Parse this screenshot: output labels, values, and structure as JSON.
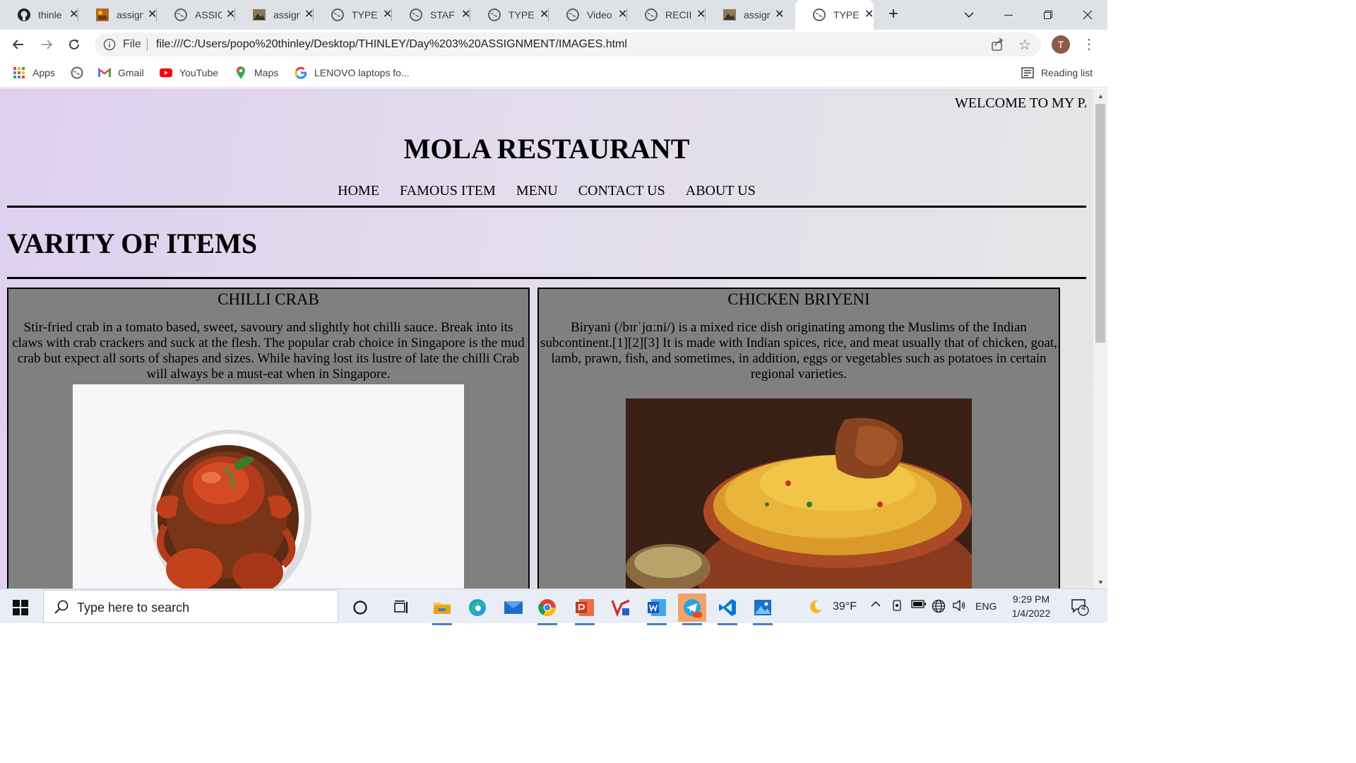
{
  "browser": {
    "tabs": [
      {
        "label": "thinle",
        "icon": "github-icon",
        "active": false
      },
      {
        "label": "assign",
        "icon": "image-icon",
        "active": false
      },
      {
        "label": "ASSIG",
        "icon": "globe-icon",
        "active": false
      },
      {
        "label": "assign",
        "icon": "image-icon",
        "active": false
      },
      {
        "label": "TYPE",
        "icon": "globe-icon",
        "active": false
      },
      {
        "label": "STAF",
        "icon": "globe-icon",
        "active": false
      },
      {
        "label": "TYPE",
        "icon": "globe-icon",
        "active": false
      },
      {
        "label": "Video",
        "icon": "globe-icon",
        "active": false
      },
      {
        "label": "RECII",
        "icon": "globe-icon",
        "active": false
      },
      {
        "label": "assign",
        "icon": "image-icon",
        "active": false
      },
      {
        "label": "TYPE",
        "icon": "globe-icon",
        "active": true
      }
    ],
    "new_tab": "+",
    "omnibox": {
      "scheme_label": "File",
      "url": "file:///C:/Users/popo%20thinley/Desktop/THINLEY/Day%203%20ASSIGNMENT/IMAGES.html"
    },
    "profile_initial": "T",
    "bookmarks": [
      {
        "label": "Apps",
        "icon": "apps-grid-icon"
      },
      {
        "label": "",
        "icon": "globe-icon"
      },
      {
        "label": "Gmail",
        "icon": "gmail-icon"
      },
      {
        "label": "YouTube",
        "icon": "youtube-icon"
      },
      {
        "label": "Maps",
        "icon": "maps-pin-icon"
      },
      {
        "label": "LENOVO laptops fo...",
        "icon": "google-icon"
      }
    ],
    "reading_list": "Reading list"
  },
  "page": {
    "marquee": "WELCOME TO MY PA",
    "site_title": "MOLA RESTAURANT",
    "nav": [
      "HOME",
      "FAMOUS ITEM",
      "MENU",
      "CONTACT US",
      "ABOUT US"
    ],
    "section_title": "VARITY OF ITEMS",
    "cards": [
      {
        "title": "CHILLI CRAB",
        "description": "Stir-fried crab in a tomato based, sweet, savoury and slightly hot chilli sauce. Break into its claws with crab crackers and suck at the flesh. The popular crab choice in Singapore is the mud crab but expect all sorts of shapes and sizes. While having lost its lustre of late the chilli Crab will always be a must-eat when in Singapore.",
        "image": "chilli-crab-photo"
      },
      {
        "title": "CHICKEN BRIYENI",
        "description": "Biryani (/bɪrˈjɑːni/) is a mixed rice dish originating among the Muslims of the Indian subcontinent.[1][2][3] It is made with Indian spices, rice, and meat usually that of chicken, goat, lamb, prawn, fish, and sometimes, in addition, eggs or vegetables such as potatoes in certain regional varieties.",
        "image": "chicken-biryani-photo"
      }
    ]
  },
  "taskbar": {
    "search_placeholder": "Type here to search",
    "weather": "39°F",
    "language": "ENG",
    "time": "9:29 PM",
    "date": "1/4/2022",
    "notification_count": "4"
  }
}
